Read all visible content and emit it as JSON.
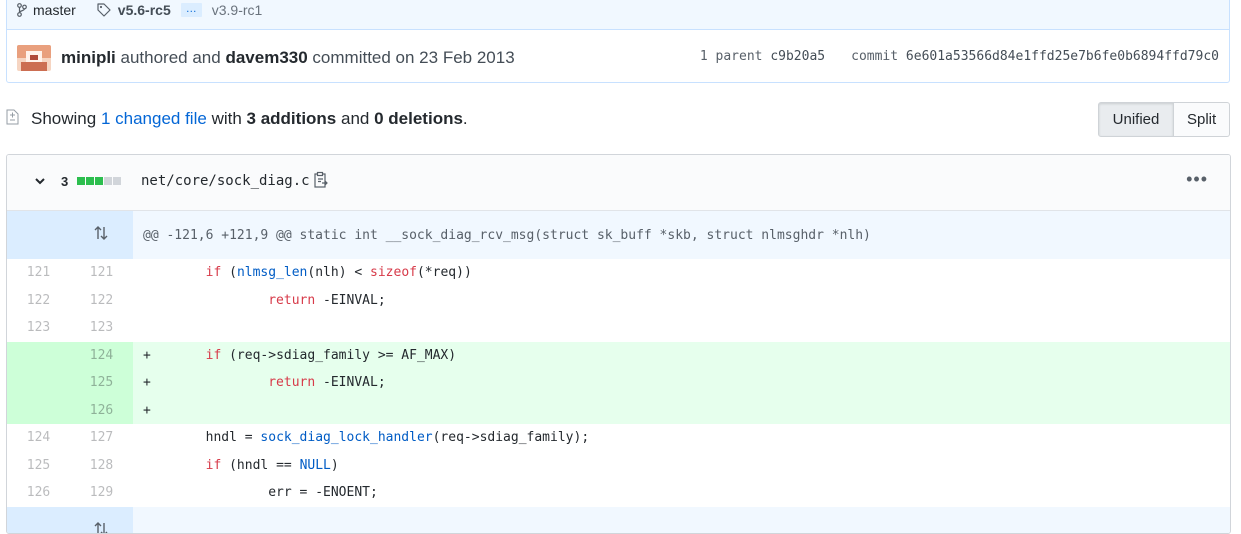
{
  "commit": {
    "branch": "master",
    "tag_first": "v5.6-rc5",
    "tag_more": "…",
    "tag_last": "v3.9-rc1",
    "author": "minipli",
    "authored_text": "authored and",
    "committer": "davem330",
    "committed_text": "committed on 23 Feb 2013",
    "parent_label": "1 parent",
    "parent_sha": "c9b20a5",
    "commit_label": "commit",
    "commit_sha": "6e601a53566d84e1ffd25e7b6fe0b6894ffd79c0"
  },
  "toc": {
    "showing": "Showing",
    "changed_files": "1 changed file",
    "with": "with",
    "additions": "3 additions",
    "and": "and",
    "deletions": "0 deletions",
    "period": "."
  },
  "view_toggle": {
    "unified": "Unified",
    "split": "Split"
  },
  "file": {
    "change_count": "3",
    "path": "net/core/sock_diag.c",
    "hunk_header": "@@ -121,6 +121,9 @@ static int __sock_diag_rcv_msg(struct sk_buff *skb, struct nlmsghdr *nlh)"
  },
  "lines": [
    {
      "old": "121",
      "new": "121",
      "marker": " ",
      "type": "context"
    },
    {
      "old": "122",
      "new": "122",
      "marker": " ",
      "type": "context"
    },
    {
      "old": "123",
      "new": "123",
      "marker": " ",
      "type": "context"
    },
    {
      "old": "",
      "new": "124",
      "marker": "+",
      "type": "add"
    },
    {
      "old": "",
      "new": "125",
      "marker": "+",
      "type": "add"
    },
    {
      "old": "",
      "new": "126",
      "marker": "+",
      "type": "add"
    },
    {
      "old": "124",
      "new": "127",
      "marker": " ",
      "type": "context"
    },
    {
      "old": "125",
      "new": "128",
      "marker": " ",
      "type": "context"
    },
    {
      "old": "126",
      "new": "129",
      "marker": " ",
      "type": "context"
    }
  ],
  "code": {
    "l1_if": "if",
    "l1_fn": "nlmsg_len",
    "l1_mid": "(nlh) < ",
    "l1_kw2": "sizeof",
    "l1_end": "(*req))",
    "l2_kw": "return",
    "l2_rest": " -EINVAL;",
    "l4_kw": "if",
    "l4_rest": " (req->sdiag_family >= AF_MAX)",
    "l5_kw": "return",
    "l5_rest": " -EINVAL;",
    "l7_a": "hndl = ",
    "l7_fn": "sock_diag_lock_handler",
    "l7_rest": "(req->sdiag_family);",
    "l8_kw": "if",
    "l8_mid": " (hndl == ",
    "l8_ct": "NULL",
    "l8_end": ")",
    "l9": "err = -ENOENT;"
  },
  "colors": {
    "addition_block": "#2cbe4e",
    "neutral_block": "#d1d5da",
    "link": "#0366d6"
  }
}
